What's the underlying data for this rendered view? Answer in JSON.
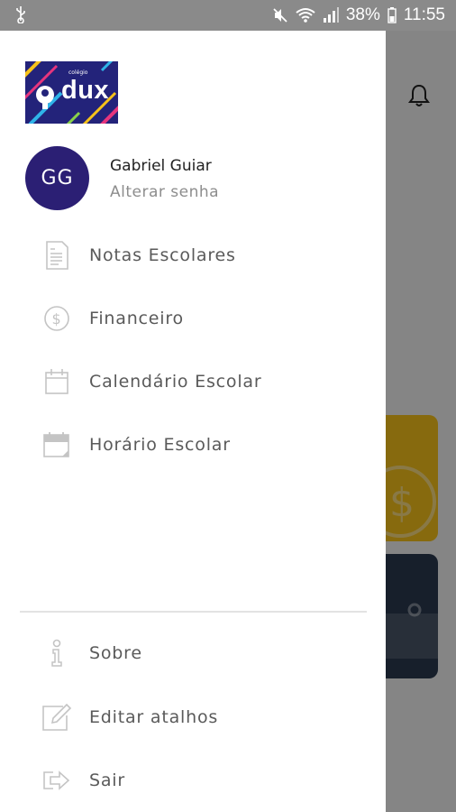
{
  "status_bar": {
    "battery": "38%",
    "time": "11:55",
    "icons": [
      "usb-icon",
      "mute-icon",
      "wifi-icon",
      "signal-icon",
      "battery-icon"
    ]
  },
  "drawer": {
    "logo": {
      "text": "dux",
      "small_text": "colégio"
    },
    "user": {
      "initials": "GG",
      "name": "Gabriel Guiar",
      "change_password": "Alterar senha"
    },
    "menu": [
      {
        "label": "Notas Escolares",
        "icon": "report-card-icon"
      },
      {
        "label": "Financeiro",
        "icon": "dollar-icon"
      },
      {
        "label": "Calendário Escolar",
        "icon": "calendar-icon"
      },
      {
        "label": "Horário Escolar",
        "icon": "schedule-icon"
      }
    ],
    "footer_menu": [
      {
        "label": "Sobre",
        "icon": "info-icon"
      },
      {
        "label": "Editar atalhos",
        "icon": "edit-icon"
      },
      {
        "label": "Sair",
        "icon": "logout-icon"
      }
    ]
  },
  "colors": {
    "avatar": "#2b1f74",
    "logo_bg": "#23237a",
    "card_yellow": "#f6c21a",
    "card_dark": "#2a3a4f"
  }
}
